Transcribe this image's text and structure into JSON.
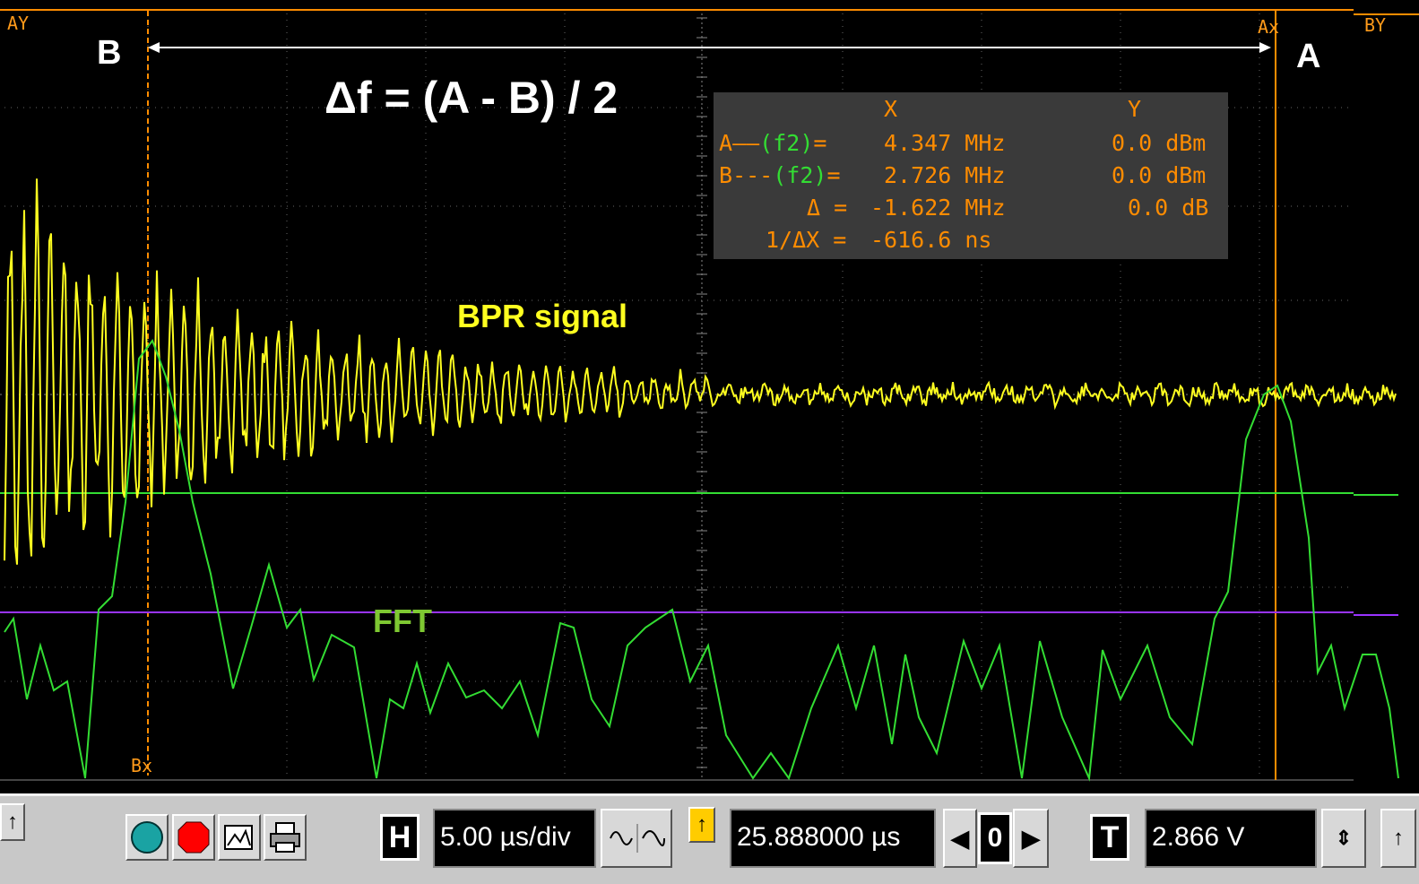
{
  "corner_labels": {
    "a_y": "AY",
    "b_y": "BY",
    "a_x": "Ax",
    "b_x": "Bx"
  },
  "annotations": {
    "marker_b": "B",
    "marker_a": "A",
    "formula": "Δf = (A - B) / 2",
    "bpr_label": "BPR signal",
    "fft_label": "FFT"
  },
  "readout": {
    "header_x": "X",
    "header_y": "Y",
    "row_a": {
      "label_prefix": "A",
      "label_line": "——",
      "label_func": "(f2)",
      "eq": "=",
      "x": "4.347 MHz",
      "y": "0.0 dBm"
    },
    "row_b": {
      "label_prefix": "B",
      "label_line": "---",
      "label_func": "(f2)",
      "eq": "=",
      "x": "2.726 MHz",
      "y": "0.0 dBm"
    },
    "row_delta": {
      "label": "Δ =",
      "x": "-1.622 MHz",
      "y": "0.0 dB"
    },
    "row_inv": {
      "label": "1/ΔX =",
      "x": "-616.6 ns"
    }
  },
  "toolbar": {
    "h_label": "H",
    "timebase": "5.00 µs/div",
    "delay": "25.888000 µs",
    "zero_label": "0",
    "t_label": "T",
    "trigger_level": "2.866 V"
  },
  "colors": {
    "bpr_trace": "#ffff20",
    "fft_trace": "#33dd33",
    "cursor": "#ff8c00",
    "purple_line": "#9933ff",
    "readout_text": "#ff8c00",
    "readout_func": "#33dd33"
  },
  "icons": [
    "up-arrow-icon",
    "record-cyan-icon",
    "record-red-icon",
    "image-icon",
    "printer-icon",
    "ac-couple-icon",
    "left-arrow-icon",
    "right-arrow-icon",
    "scroll-updown-icon"
  ]
}
